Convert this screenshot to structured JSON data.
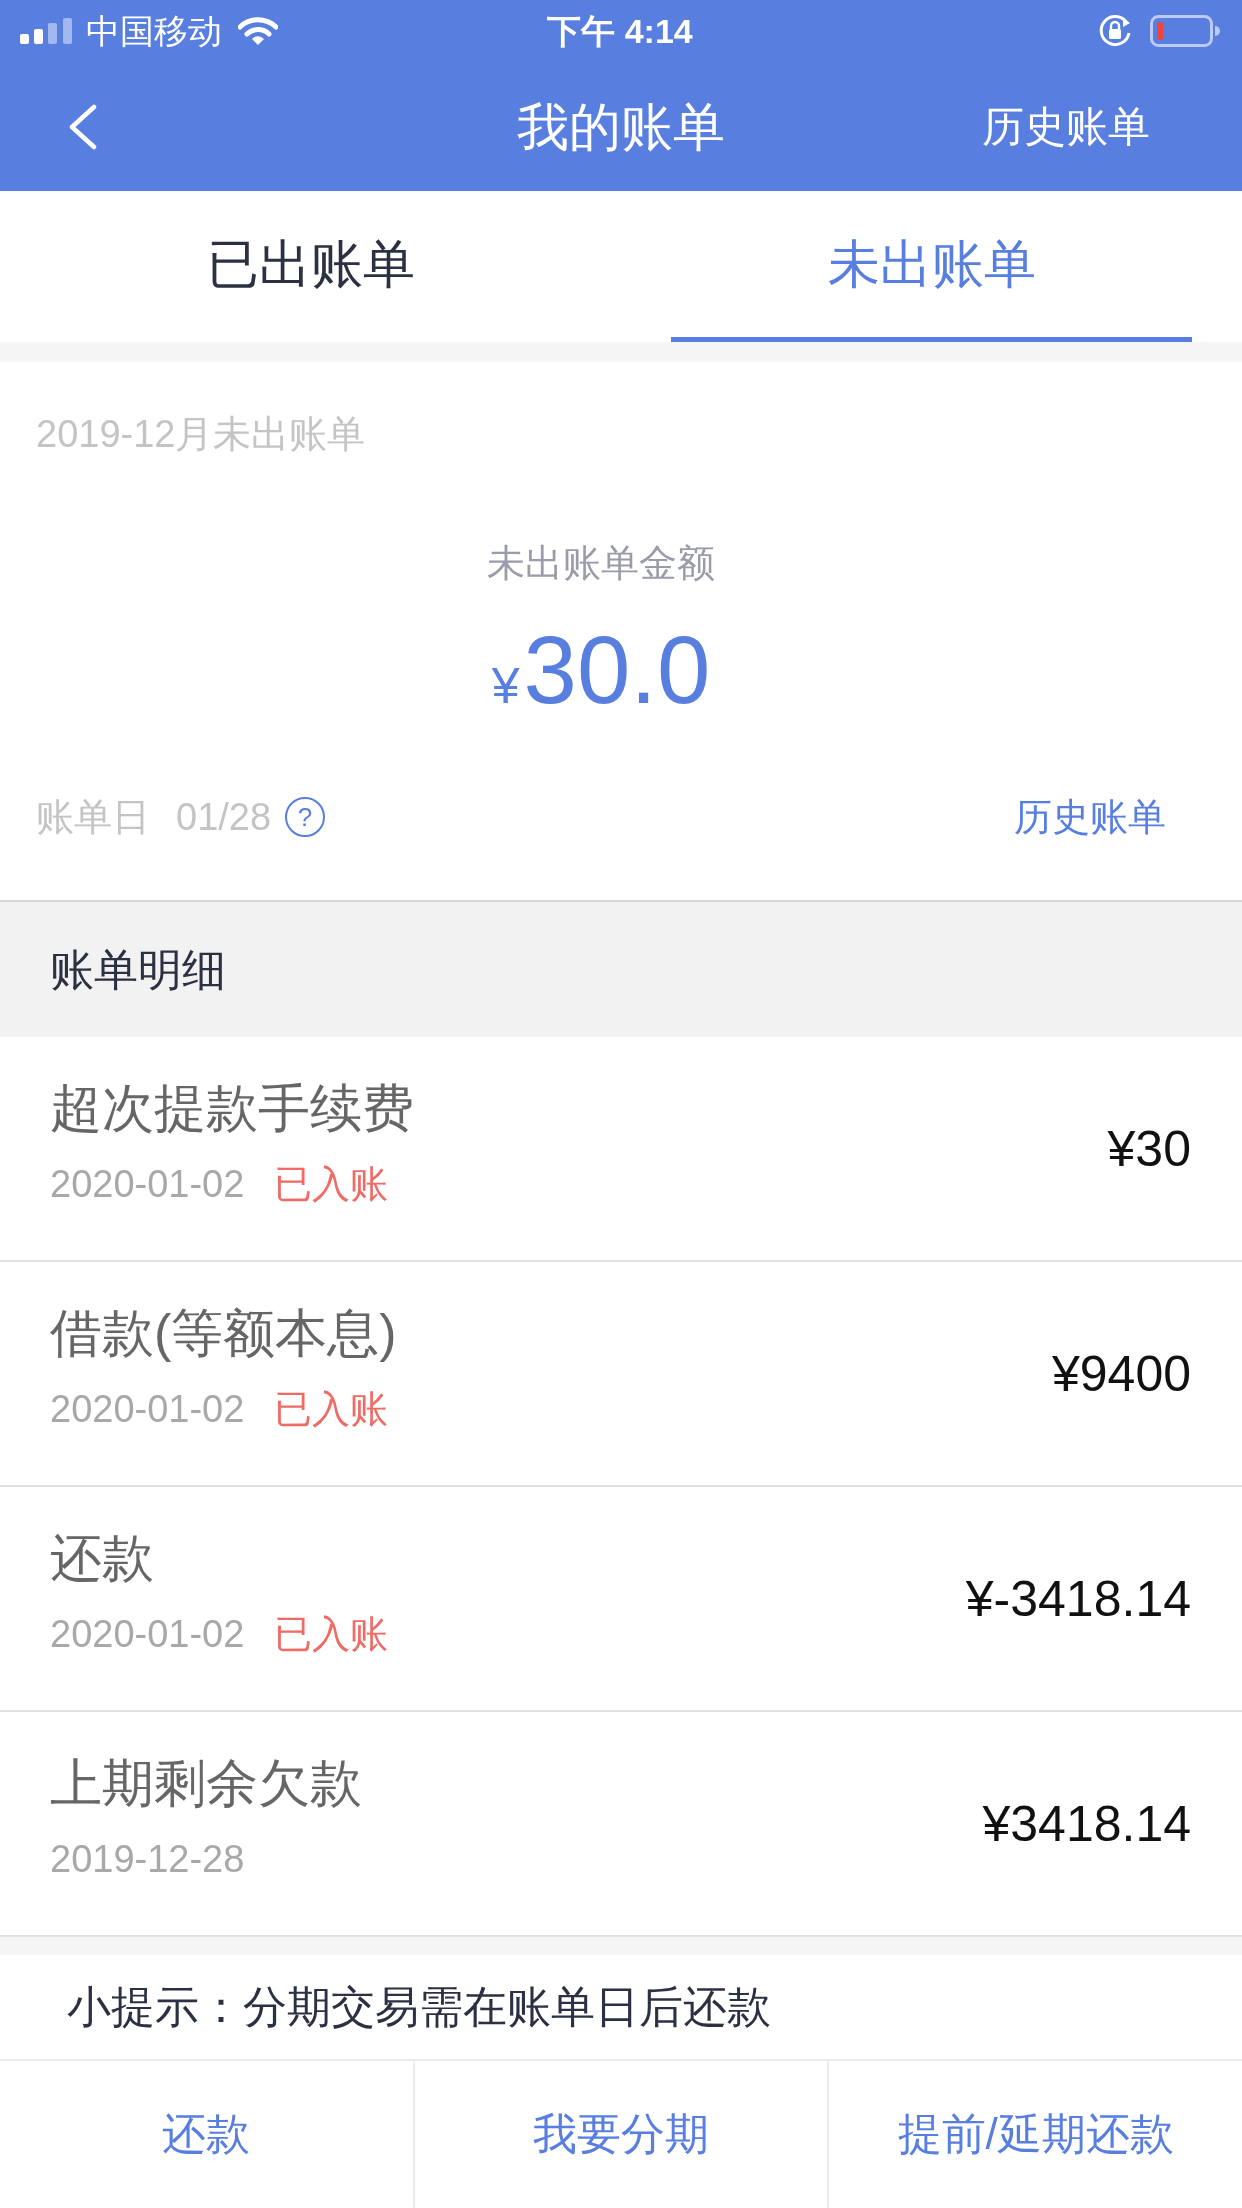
{
  "status_bar": {
    "carrier": "中国移动",
    "time": "下午 4:14"
  },
  "nav_bar": {
    "title": "我的账单",
    "action": "历史账单"
  },
  "tabs": [
    {
      "label": "已出账单",
      "selected": false
    },
    {
      "label": "未出账单",
      "selected": true
    }
  ],
  "summary": {
    "period": "2019-12月未出账单",
    "amount_label": "未出账单金额",
    "currency": "¥",
    "amount": "30.0",
    "bill_day_label": "账单日",
    "bill_day": "01/28",
    "help_icon": "?",
    "history_link": "历史账单"
  },
  "details": {
    "title": "账单明细",
    "items": [
      {
        "name": "超次提款手续费",
        "date": "2020-01-02",
        "status": "已入账",
        "amount": "¥30"
      },
      {
        "name": "借款(等额本息)",
        "date": "2020-01-02",
        "status": "已入账",
        "amount": "¥9400"
      },
      {
        "name": "还款",
        "date": "2020-01-02",
        "status": "已入账",
        "amount": "¥-3418.14"
      },
      {
        "name": "上期剩余欠款",
        "date": "2019-12-28",
        "amount": "¥3418.14"
      }
    ]
  },
  "tip": "小提示：分期交易需在账单日后还款",
  "actions": [
    "还款",
    "我要分期",
    "提前/延期还款"
  ]
}
